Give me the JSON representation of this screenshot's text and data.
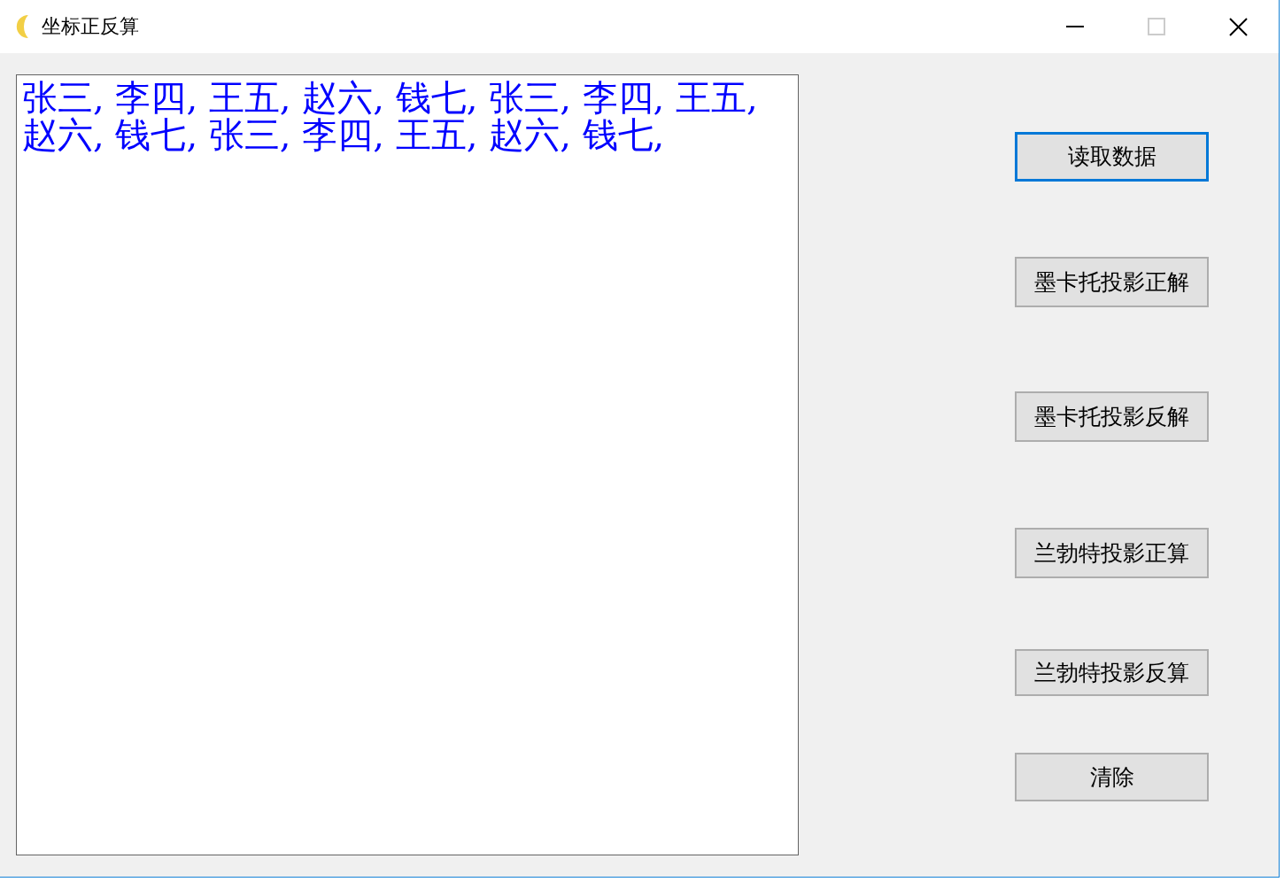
{
  "window": {
    "title": "坐标正反算",
    "controls": [
      {
        "kind": "minimize",
        "disabled": false
      },
      {
        "kind": "maximize",
        "disabled": true
      },
      {
        "kind": "close",
        "disabled": false
      }
    ]
  },
  "output_box": {
    "value": "张三, 李四, 王五, 赵六, 钱七, 张三, 李四, 王五, 赵六, 钱七, 张三, 李四, 王五, 赵六, 钱七,"
  },
  "buttons": [
    {
      "label": "读取数据",
      "focused": true
    },
    {
      "label": "墨卡托投影正解",
      "focused": false
    },
    {
      "label": "墨卡托投影反解",
      "focused": false
    },
    {
      "label": "兰勃特投影正算",
      "focused": false
    },
    {
      "label": "兰勃特投影反算",
      "focused": false
    },
    {
      "label": "清除",
      "focused": false
    }
  ]
}
